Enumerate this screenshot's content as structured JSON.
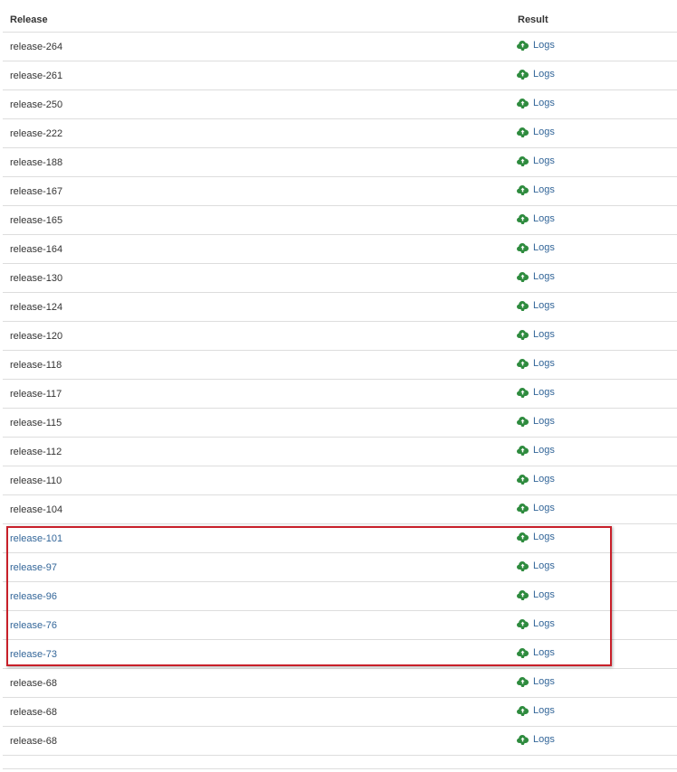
{
  "table": {
    "headers": {
      "release": "Release",
      "result": "Result"
    },
    "rows": [
      {
        "release": "release-264",
        "result": "Logs",
        "release_is_link": false
      },
      {
        "release": "release-261",
        "result": "Logs",
        "release_is_link": false
      },
      {
        "release": "release-250",
        "result": "Logs",
        "release_is_link": false
      },
      {
        "release": "release-222",
        "result": "Logs",
        "release_is_link": false
      },
      {
        "release": "release-188",
        "result": "Logs",
        "release_is_link": false
      },
      {
        "release": "release-167",
        "result": "Logs",
        "release_is_link": false
      },
      {
        "release": "release-165",
        "result": "Logs",
        "release_is_link": false
      },
      {
        "release": "release-164",
        "result": "Logs",
        "release_is_link": false
      },
      {
        "release": "release-130",
        "result": "Logs",
        "release_is_link": false
      },
      {
        "release": "release-124",
        "result": "Logs",
        "release_is_link": false
      },
      {
        "release": "release-120",
        "result": "Logs",
        "release_is_link": false
      },
      {
        "release": "release-118",
        "result": "Logs",
        "release_is_link": false
      },
      {
        "release": "release-117",
        "result": "Logs",
        "release_is_link": false
      },
      {
        "release": "release-115",
        "result": "Logs",
        "release_is_link": false
      },
      {
        "release": "release-112",
        "result": "Logs",
        "release_is_link": false
      },
      {
        "release": "release-110",
        "result": "Logs",
        "release_is_link": false
      },
      {
        "release": "release-104",
        "result": "Logs",
        "release_is_link": false
      },
      {
        "release": "release-101",
        "result": "Logs",
        "release_is_link": true
      },
      {
        "release": "release-97",
        "result": "Logs",
        "release_is_link": true
      },
      {
        "release": "release-96",
        "result": "Logs",
        "release_is_link": true
      },
      {
        "release": "release-76",
        "result": "Logs",
        "release_is_link": true
      },
      {
        "release": "release-73",
        "result": "Logs",
        "release_is_link": true
      },
      {
        "release": "release-68",
        "result": "Logs",
        "release_is_link": false
      },
      {
        "release": "release-68",
        "result": "Logs",
        "release_is_link": false
      },
      {
        "release": "release-68",
        "result": "Logs",
        "release_is_link": false
      }
    ],
    "result_icon": "cloud-upload-icon",
    "highlight_rows": [
      17,
      21
    ]
  },
  "colors": {
    "link": "#336699",
    "icon": "#2e8b3e",
    "border": "#dddddd",
    "highlight": "#c8202a"
  }
}
